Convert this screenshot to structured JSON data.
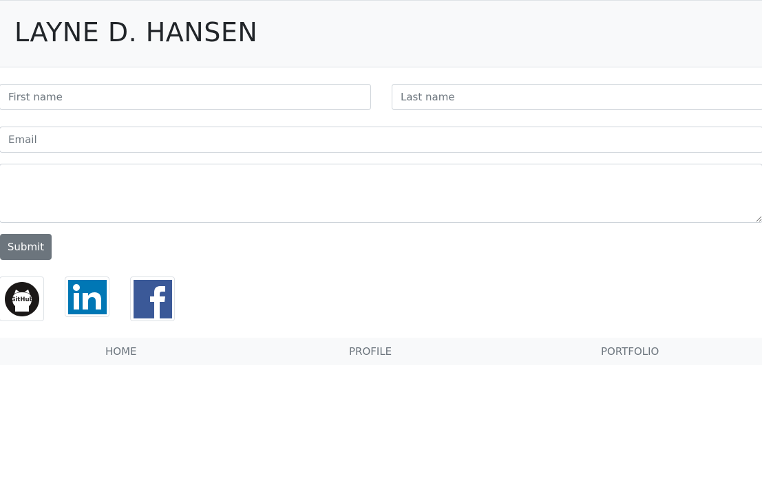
{
  "header": {
    "title": "LAYNE D. HANSEN"
  },
  "form": {
    "first_name_placeholder": "First name",
    "last_name_placeholder": "Last name",
    "email_placeholder": "Email",
    "message_value": "",
    "submit_label": "Submit"
  },
  "social": [
    {
      "name": "github-icon",
      "label": "GitHub"
    },
    {
      "name": "linkedin-icon",
      "label": "in"
    },
    {
      "name": "facebook-icon",
      "label": "f"
    }
  ],
  "nav": {
    "home": "HOME",
    "profile": "PROFILE",
    "portfolio": "PORTFOLIO"
  },
  "colors": {
    "header_bg": "#f8f9fa",
    "submit_bg": "#6c757d",
    "linkedin": "#0077b5",
    "facebook": "#3b5998",
    "github": "#1b1817"
  }
}
